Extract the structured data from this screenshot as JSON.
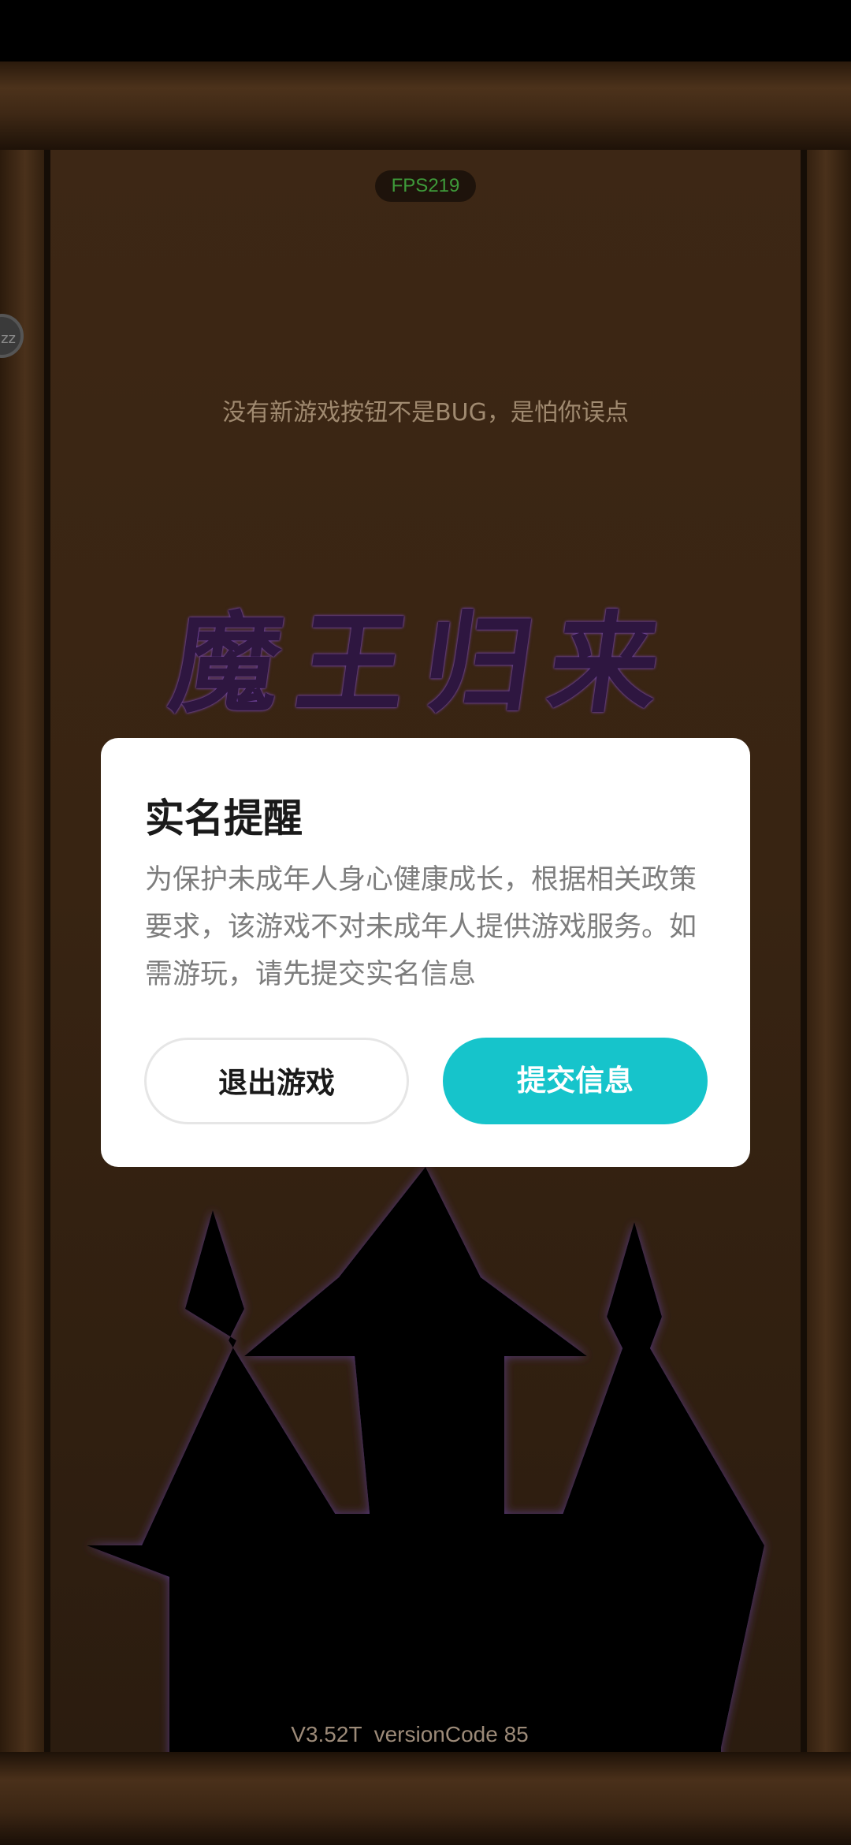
{
  "fps_label": "FPS219",
  "hint_text": "没有新游戏按钮不是BUG，是怕你误点",
  "game_title": "魔王归来",
  "version_label": "V3.52T  versionCode 85",
  "dialog": {
    "title": "实名提醒",
    "body": "为保护未成年人身心健康成长，根据相关政策要求，该游戏不对未成年人提供游戏服务。如需游玩，请先提交实名信息",
    "exit_button": "退出游戏",
    "submit_button": "提交信息"
  },
  "colors": {
    "accent": "#16c4cb",
    "title_purple": "#2e1640",
    "wood": "#382412"
  },
  "icons": {
    "side_button": "zzz-sleep-icon"
  }
}
